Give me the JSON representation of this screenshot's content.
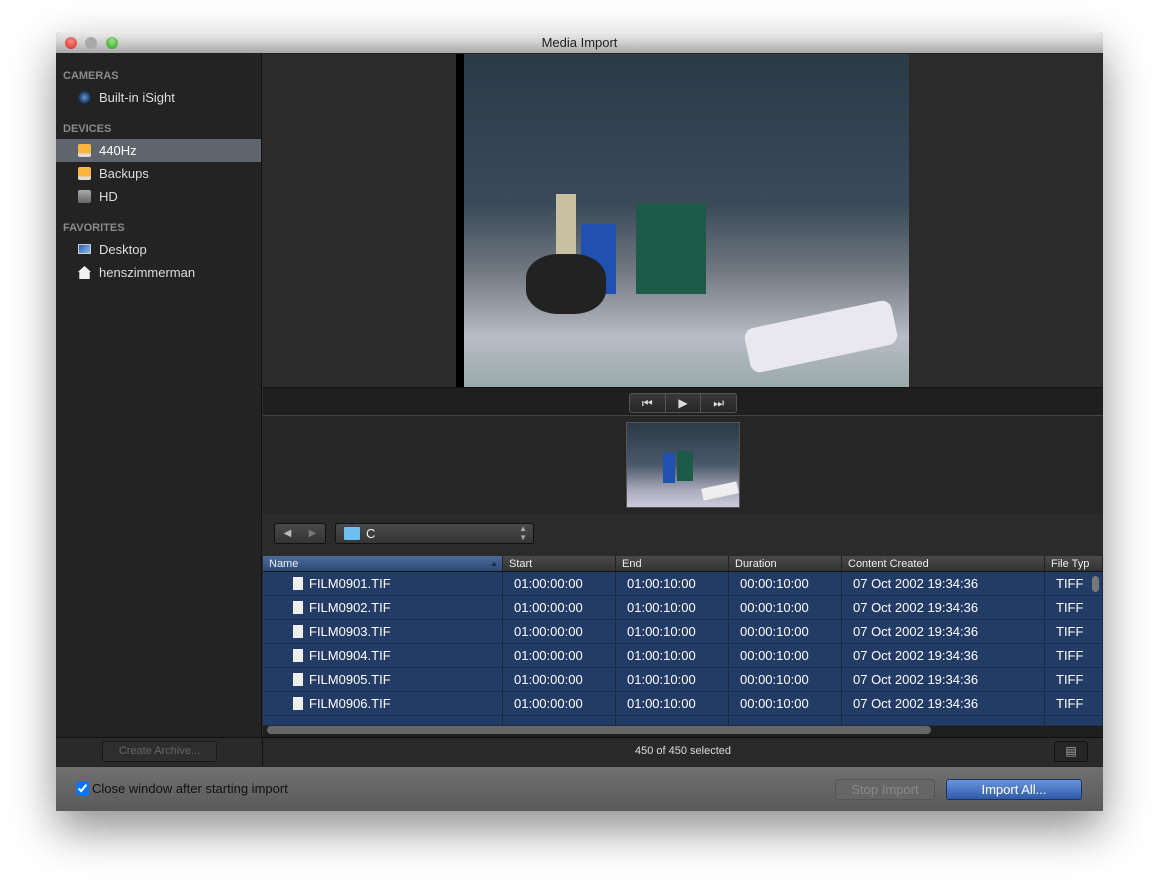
{
  "window": {
    "title": "Media Import"
  },
  "sidebar": {
    "sections": [
      {
        "title": "CAMERAS",
        "items": [
          {
            "label": "Built-in iSight",
            "icon": "camera-icon"
          }
        ]
      },
      {
        "title": "DEVICES",
        "items": [
          {
            "label": "440Hz",
            "icon": "external-drive-icon",
            "selected": true
          },
          {
            "label": "Backups",
            "icon": "external-drive-icon"
          },
          {
            "label": "HD",
            "icon": "hard-drive-icon"
          }
        ]
      },
      {
        "title": "FAVORITES",
        "items": [
          {
            "label": "Desktop",
            "icon": "desktop-icon"
          },
          {
            "label": "henszimmerman",
            "icon": "home-icon"
          }
        ]
      }
    ],
    "create_archive": "Create Archive..."
  },
  "transport": {
    "prev": "⏮",
    "play": "▶",
    "next": "⏭"
  },
  "browser": {
    "back": "◀",
    "forward": "▶",
    "folder": "C"
  },
  "table": {
    "columns": [
      "Name",
      "Start",
      "End",
      "Duration",
      "Content Created",
      "File Typ"
    ],
    "rows": [
      [
        "FILM0901.TIF",
        "01:00:00:00",
        "01:00:10:00",
        "00:00:10:00",
        "07 Oct 2002 19:34:36",
        "TIFF"
      ],
      [
        "FILM0902.TIF",
        "01:00:00:00",
        "01:00:10:00",
        "00:00:10:00",
        "07 Oct 2002 19:34:36",
        "TIFF"
      ],
      [
        "FILM0903.TIF",
        "01:00:00:00",
        "01:00:10:00",
        "00:00:10:00",
        "07 Oct 2002 19:34:36",
        "TIFF"
      ],
      [
        "FILM0904.TIF",
        "01:00:00:00",
        "01:00:10:00",
        "00:00:10:00",
        "07 Oct 2002 19:34:36",
        "TIFF"
      ],
      [
        "FILM0905.TIF",
        "01:00:00:00",
        "01:00:10:00",
        "00:00:10:00",
        "07 Oct 2002 19:34:36",
        "TIFF"
      ],
      [
        "FILM0906.TIF",
        "01:00:00:00",
        "01:00:10:00",
        "00:00:10:00",
        "07 Oct 2002 19:34:36",
        "TIFF"
      ]
    ]
  },
  "status": {
    "selection": "450 of 450 selected"
  },
  "footer": {
    "close_window_label": "Close window after starting import",
    "close_window_checked": true,
    "stop_import": "Stop Import",
    "import_all": "Import All..."
  },
  "colors": {
    "selection": "#223c66",
    "accent": "#3a64b0"
  }
}
